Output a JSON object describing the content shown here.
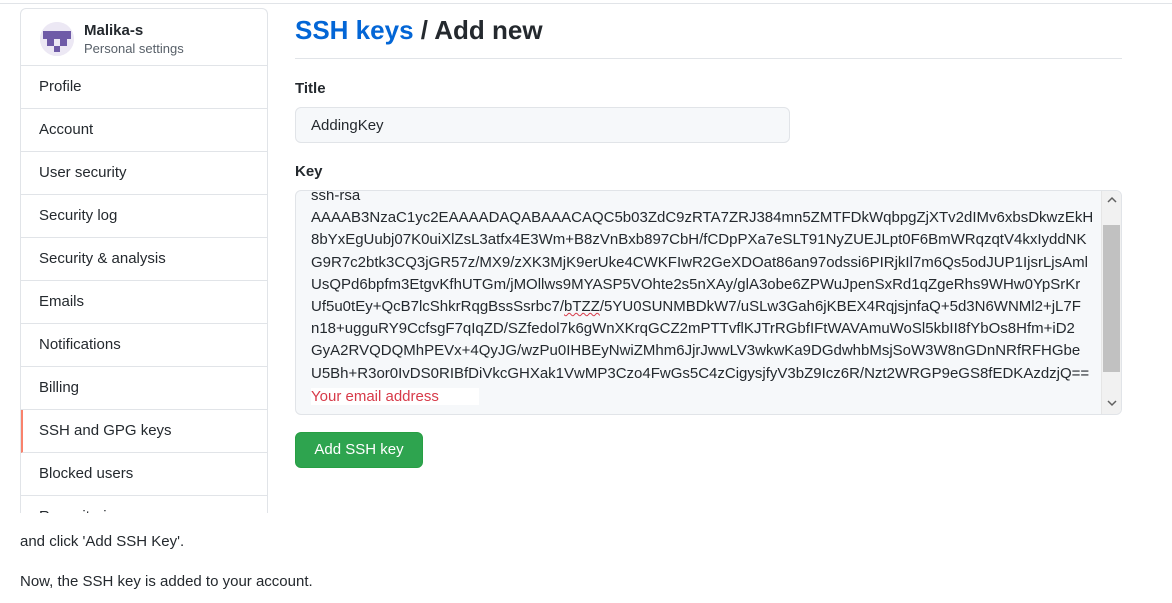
{
  "user": {
    "name": "Malika-s",
    "subtitle": "Personal settings"
  },
  "sidebar": {
    "items": [
      {
        "label": "Profile"
      },
      {
        "label": "Account"
      },
      {
        "label": "User security"
      },
      {
        "label": "Security log"
      },
      {
        "label": "Security & analysis"
      },
      {
        "label": "Emails"
      },
      {
        "label": "Notifications"
      },
      {
        "label": "Billing"
      },
      {
        "label": "SSH and GPG keys",
        "selected": true
      },
      {
        "label": "Blocked users"
      },
      {
        "label": "Repositories"
      }
    ]
  },
  "header": {
    "breadcrumb_link": "SSH keys",
    "separator": " / ",
    "current": "Add new"
  },
  "form": {
    "title_label": "Title",
    "title_value": "AddingKey",
    "key_label": "Key",
    "key_lines": [
      "ssh-rsa",
      "AAAAB3NzaC1yc2EAAAADAQABAAACAQC5b03ZdC9zRTA7ZRJ384mn5ZMTFDkWqbpgZjXTv2dIMv6xbsDkwzEkH",
      "8bYxEgUubj07K0uiXlZsL3atfx4E3Wm+B8zVnBxb897CbH/fCDpPXa7eSLT91NyZUEJLpt0F6BmWRqzqtV4kxIyddNK",
      "G9R7c2btk3CQ3jGR57z/MX9/zXK3MjK9erUke4CWKFIwR2GeXDOat86an97odssi6PIRjkIl7m6Qs5odJUP1IjsrLjsAml",
      "UsQPd6bpfm3EtgvKfhUTGm/jMOllws9MYASP5VOhte2s5nXAy/glA3obe6ZPWuJpenSxRd1qZgeRhs9WHw0YpSrKr",
      "Uf5u0tEy+QcB7lcShkrRqgBssSsrbc7/",
      "bTZZ",
      "/5YU0SUNMBDkW7/uSLw3Gah6jKBEX4RqjsjnfaQ+5d3N6WNMl2+jL7F",
      "n18+ugguRY9CcfsgF7qIqZD/SZfedol7k6gWnXKrqGCZ2mPTTvflKJTrRGbfIFtWAVAmuWoSl5kbII8fYbOs8Hfm+iD2",
      "GyA2RVQDQMhPEVx+4QyJG/wzPu0IHBEyNwiZMhm6JjrJwwLV3wkwKa9DGdwhbMsjSoW3W8nGDnNRfRFHGbe",
      "U5Bh+R3or0IvDS0RIBfDiVkcGHXak1VwMP3Czo4FwGs5C4zCigysjfyV3bZ9Icz6R/Nzt2WRGP9eGS8fEDKAzdzjQ=="
    ],
    "key_overlay_text": "Your email address",
    "submit_label": "Add SSH key"
  },
  "instructions": {
    "line1": "and click 'Add SSH Key'.",
    "line2": "Now, the SSH key is added to your account."
  },
  "icons": {
    "scroll_up": "chevron-up-icon",
    "scroll_down": "chevron-down-icon"
  },
  "colors": {
    "link": "#0366d6",
    "primary_button": "#2ea44f",
    "selected_accent": "#f9826c",
    "annotation_red": "#d73a49"
  }
}
